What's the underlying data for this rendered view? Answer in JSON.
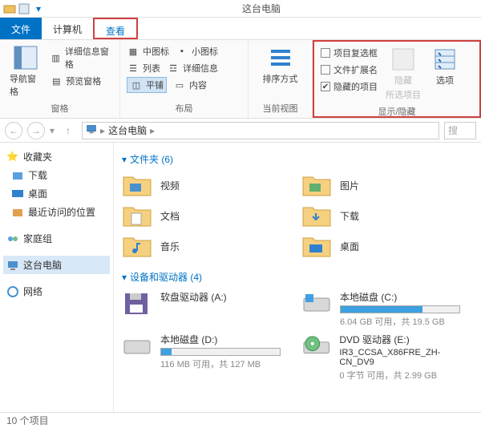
{
  "window": {
    "title": "这台电脑"
  },
  "tabs": {
    "file": "文件",
    "computer": "计算机",
    "view": "查看"
  },
  "ribbon": {
    "panes": {
      "nav": "导航窗格",
      "detail_pane": "详细信息窗格",
      "preview_pane": "预览窗格",
      "label": "窗格"
    },
    "layout": {
      "medium_icons": "中图标",
      "small_icons": "小图标",
      "list": "列表",
      "details": "详细信息",
      "tiles": "平铺",
      "content": "内容",
      "label": "布局"
    },
    "currentview": {
      "sort": "排序方式",
      "label": "当前视图"
    },
    "showhide": {
      "checkboxes": "项目复选框",
      "extensions": "文件扩展名",
      "hidden": "隐藏的项目",
      "hide_btn": "隐藏",
      "selected": "所选项目",
      "label": "显示/隐藏"
    },
    "options": "选项"
  },
  "address": {
    "root": "这台电脑",
    "search_placeholder": "搜"
  },
  "sidebar": {
    "fav": "收藏夹",
    "downloads": "下载",
    "desktop": "桌面",
    "recent": "最近访问的位置",
    "homegroup": "家庭组",
    "thispc": "这台电脑",
    "network": "网络"
  },
  "content": {
    "folders_header": "文件夹 (6)",
    "devices_header": "设备和驱动器 (4)",
    "folders": {
      "videos": "视频",
      "pictures": "图片",
      "documents": "文档",
      "downloads": "下载",
      "music": "音乐",
      "desktop": "桌面"
    },
    "drives": {
      "a": {
        "name": "软盘驱动器 (A:)"
      },
      "c": {
        "name": "本地磁盘 (C:)",
        "sub": "6.04 GB 可用，共 19.5 GB",
        "fill": 69
      },
      "d": {
        "name": "本地磁盘 (D:)",
        "sub": "116 MB 可用，共 127 MB",
        "fill": 9
      },
      "e": {
        "name": "DVD 驱动器 (E:)",
        "line2": "IR3_CCSA_X86FRE_ZH-CN_DV9",
        "sub": "0 字节 可用，共 2.99 GB"
      }
    }
  },
  "status": {
    "items": "10 个项目"
  }
}
